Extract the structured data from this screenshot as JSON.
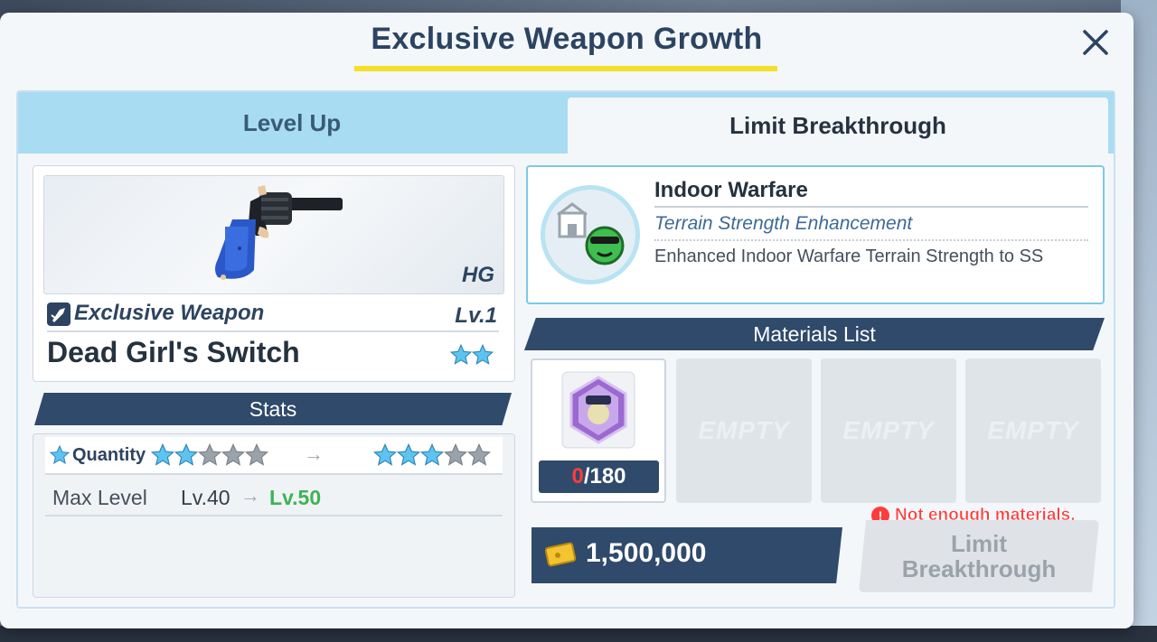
{
  "modal": {
    "title": "Exclusive Weapon Growth"
  },
  "tabs": [
    {
      "label": "Level Up"
    },
    {
      "label": "Limit Breakthrough"
    }
  ],
  "weapon": {
    "type": "HG",
    "category": "Exclusive Weapon",
    "level": "Lv.1",
    "name": "Dead Girl's Switch",
    "stars": 2
  },
  "stats": {
    "header": "Stats",
    "quantity_label": "Quantity",
    "quantity_from_stars": 2,
    "quantity_to_stars": 3,
    "quantity_max_stars": 5,
    "max_level_label": "Max Level",
    "max_level_from": "Lv.40",
    "max_level_to": "Lv.50"
  },
  "skill": {
    "title": "Indoor Warfare",
    "subtitle": "Terrain Strength Enhancement",
    "description": "Enhanced Indoor Warfare Terrain Strength to SS"
  },
  "materials": {
    "header": "Materials List",
    "item_count_have": "0",
    "item_count_need": "/180",
    "empty_label": "EMPTY"
  },
  "credits": {
    "amount": "1,500,000"
  },
  "warning": "Not enough materials.",
  "action_button": "Limit Breakthrough",
  "colors": {
    "accent_navy": "#2f4a6b",
    "tab_active": "#a8dcf2",
    "warn_red": "#ff3c3c",
    "level_green": "#3db454",
    "star_blue": "#5ec4ef"
  }
}
